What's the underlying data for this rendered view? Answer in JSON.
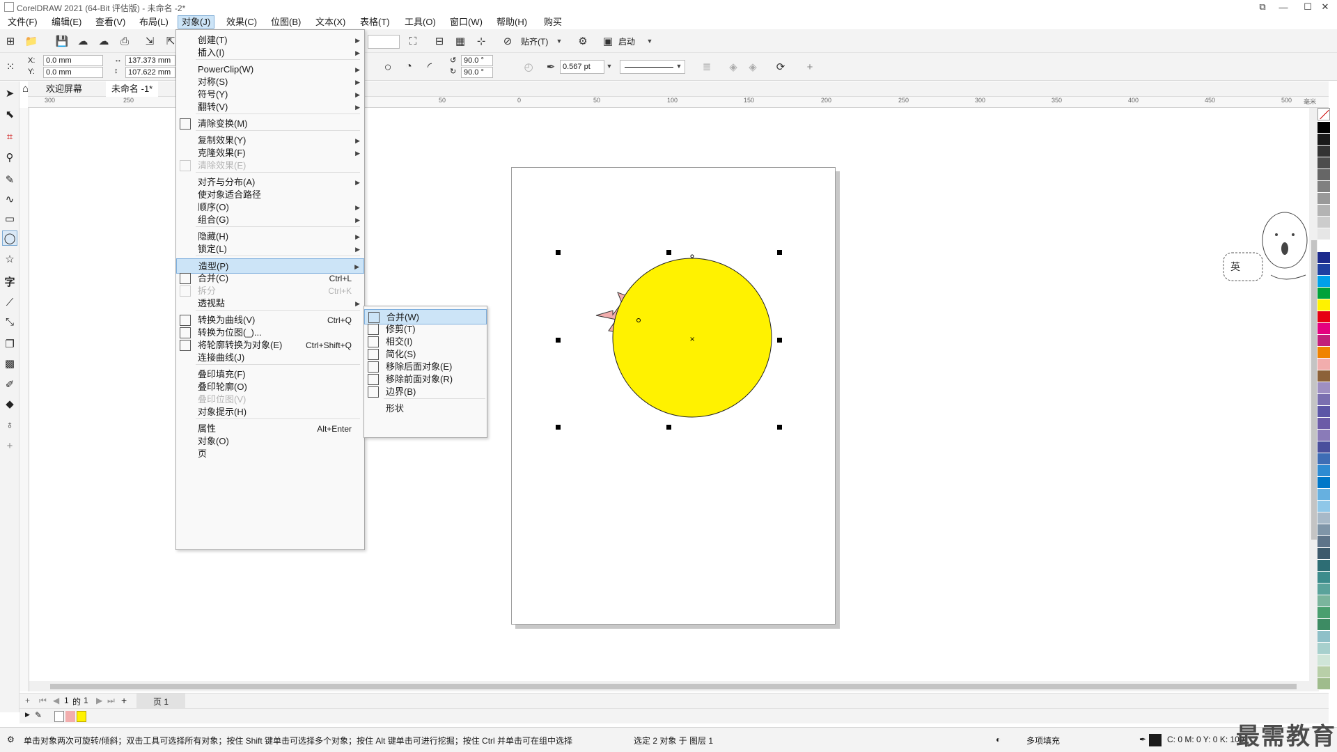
{
  "window": {
    "title": "CorelDRAW 2021 (64-Bit 评估版) - 未命名 -2*",
    "minimize": "—",
    "maximize": "☐",
    "close": "✕"
  },
  "menubar": [
    "文件(F)",
    "编辑(E)",
    "查看(V)",
    "布局(L)",
    "对象(J)",
    "效果(C)",
    "位图(B)",
    "文本(X)",
    "表格(T)",
    "工具(O)",
    "窗口(W)",
    "帮助(H)",
    "购买"
  ],
  "toolbar": {
    "snap_label": "贴齐(T)",
    "launch_label": "启动"
  },
  "propertybar": {
    "x_label": "X:",
    "y_label": "Y:",
    "x_value": "0.0 mm",
    "y_value": "0.0 mm",
    "width_value": "137.373 mm",
    "height_value": "107.622 mm",
    "angle1": "90.0 °",
    "angle2": "90.0 °",
    "outline_width": "0.567 pt"
  },
  "doctabs": {
    "welcome": "欢迎屏幕",
    "document": "未命名 -1*"
  },
  "rulers": {
    "h_ticks": [
      "300",
      "250",
      "50",
      "0",
      "50",
      "100",
      "150",
      "200",
      "250",
      "300",
      "350",
      "400",
      "450",
      "500",
      "毫米"
    ]
  },
  "object_menu": {
    "items": [
      {
        "label": "创建(T)",
        "arrow": "▶"
      },
      {
        "label": "插入(I)",
        "arrow": "▶"
      },
      {
        "label": "PowerClip(W)",
        "arrow": "▶"
      },
      {
        "label": "对称(S)",
        "arrow": "▶"
      },
      {
        "label": "符号(Y)",
        "arrow": "▶"
      },
      {
        "label": "翻转(V)",
        "arrow": "▶"
      },
      {
        "label": "清除变换(M)"
      },
      {
        "label": "复制效果(Y)",
        "arrow": "▶"
      },
      {
        "label": "克隆效果(F)",
        "arrow": "▶"
      },
      {
        "label": "清除效果(E)"
      },
      {
        "label": "对齐与分布(A)",
        "arrow": "▶"
      },
      {
        "label": "使对象适合路径"
      },
      {
        "label": "顺序(O)",
        "arrow": "▶"
      },
      {
        "label": "组合(G)",
        "arrow": "▶"
      },
      {
        "label": "隐藏(H)",
        "arrow": "▶"
      },
      {
        "label": "锁定(L)",
        "arrow": "▶"
      },
      {
        "label": "造型(P)",
        "arrow": "▶"
      },
      {
        "label": "合并(C)",
        "shortcut": "Ctrl+L"
      },
      {
        "label": "拆分",
        "shortcut": "Ctrl+K"
      },
      {
        "label": "透视點",
        "arrow": "▶"
      },
      {
        "label": "转换为曲线(V)",
        "shortcut": "Ctrl+Q"
      },
      {
        "label": "转换为位图(_)..."
      },
      {
        "label": "将轮廓转换为对象(E)",
        "shortcut": "Ctrl+Shift+Q"
      },
      {
        "label": "连接曲线(J)"
      },
      {
        "label": "叠印填充(F)"
      },
      {
        "label": "叠印轮廓(O)"
      },
      {
        "label": "叠印位图(V)"
      },
      {
        "label": "对象提示(H)"
      },
      {
        "label": "属性",
        "shortcut": "Alt+Enter"
      },
      {
        "label": "对象(O)"
      },
      {
        "label": "页"
      }
    ]
  },
  "shaping_submenu": {
    "items": [
      "合并(W)",
      "修剪(T)",
      "相交(I)",
      "简化(S)",
      "移除后面对象(E)",
      "移除前面对象(R)",
      "边界(B)",
      "形状"
    ]
  },
  "pagenav": {
    "current": "1",
    "of": "的",
    "total": "1",
    "page_tab": "页 1"
  },
  "statusbar": {
    "hint": "单击对象两次可旋转/倾斜；双击工具可选择所有对象；按住 Shift 键单击可选择多个对象；按住 Alt 键单击可进行挖掘；按住 Ctrl 并单击可在组中选择",
    "selection": "选定 2 对象 于 图层 1",
    "fill_label": "多项填充",
    "cmyk": "C: 0 M: 0 Y: 0 K: 100"
  },
  "colors": {
    "sun_fill": "#fff200",
    "star_fill": "#f2adad",
    "menu_highlight": "#cce4f7",
    "palette": [
      "#000000",
      "#1a1a1a",
      "#333333",
      "#4d4d4d",
      "#666666",
      "#808080",
      "#999999",
      "#b3b3b3",
      "#cccccc",
      "#e6e6e6",
      "#ffffff",
      "#1c2a8c",
      "#1f3fa0",
      "#00a0e9",
      "#00a23a",
      "#fff200",
      "#e60012",
      "#e4007f",
      "#c21f7a",
      "#f08300",
      "#f2adad",
      "#8c6239",
      "#9e8fc2",
      "#7a6fb0",
      "#5c56a6",
      "#6b5ba7",
      "#8a7bb8",
      "#4a4f9c",
      "#3e6db5",
      "#2e8bd2",
      "#0077c8",
      "#66b0e0",
      "#8fc7e8",
      "#a8b9c8",
      "#7f95a8",
      "#5e7489",
      "#3d5a6c",
      "#2d6d74",
      "#3c8c8c",
      "#5aa39b",
      "#7bb59d",
      "#4a9f6f",
      "#3d8b63",
      "#8fc0c8",
      "#a7d0cd",
      "#cfe5d8",
      "#b8cfa8",
      "#9fbc8c"
    ]
  },
  "watermark": "最需教育"
}
